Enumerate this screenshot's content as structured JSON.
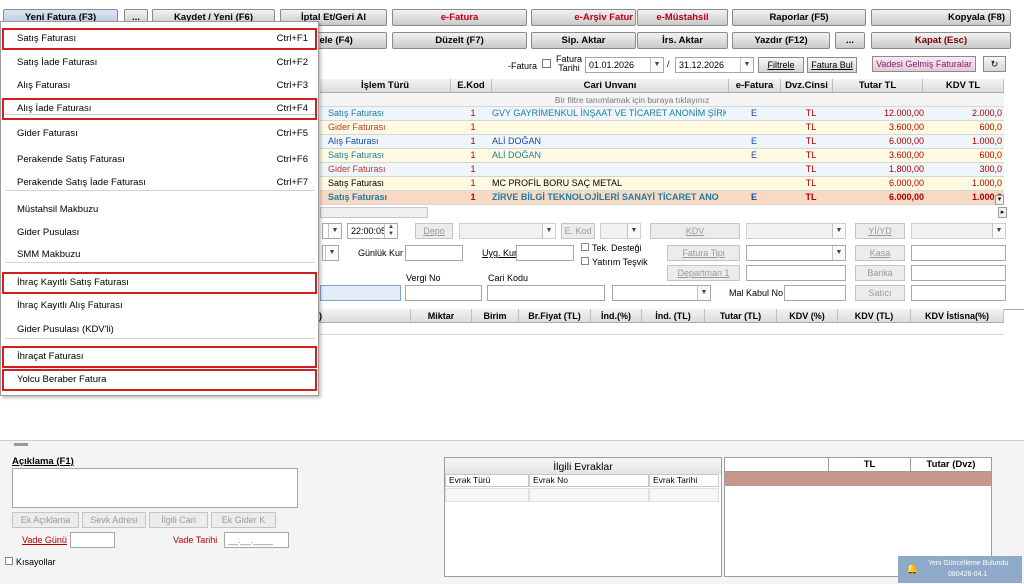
{
  "toolbar": {
    "row1": [
      "Yeni Fatura (F3)",
      "...",
      "Kaydet / Yeni (F6)",
      "İptal Et/Geri Al",
      "e-Fatura",
      "e-Arşiv Fatur",
      "e-Müstahsil",
      "Raporlar (F5)",
      "Kopyala (F8)"
    ],
    "row2": [
      "çele (F4)",
      "Düzelt (F7)",
      "Sip. Aktar",
      "İrs. Aktar",
      "Yazdır (F12)",
      "...",
      "Kapat (Esc)"
    ]
  },
  "menu": {
    "items": [
      {
        "label": "Satış Faturası",
        "shortcut": "Ctrl+F1"
      },
      {
        "label": "Satış İade Faturası",
        "shortcut": "Ctrl+F2"
      },
      {
        "label": "Alış Faturası",
        "shortcut": "Ctrl+F3"
      },
      {
        "label": "Alış İade Faturası",
        "shortcut": "Ctrl+F4"
      },
      {
        "label": "Gider Faturası",
        "shortcut": "Ctrl+F5"
      },
      {
        "label": "Perakende Satış Faturası",
        "shortcut": "Ctrl+F6"
      },
      {
        "label": "Perakende Satış İade Faturası",
        "shortcut": "Ctrl+F7"
      },
      {
        "label": "Müstahsil Makbuzu",
        "shortcut": ""
      },
      {
        "label": "Gider Pusulası",
        "shortcut": ""
      },
      {
        "label": "SMM Makbuzu",
        "shortcut": ""
      },
      {
        "label": "İhraç Kayıtlı Satış Faturası",
        "shortcut": ""
      },
      {
        "label": "İhraç Kayıtlı Alış Faturası",
        "shortcut": ""
      },
      {
        "label": "Gider Pusulası (KDV'li)",
        "shortcut": ""
      },
      {
        "label": "İhraçat Faturası",
        "shortcut": ""
      },
      {
        "label": "Yolcu Beraber Fatura",
        "shortcut": ""
      }
    ]
  },
  "filter": {
    "label_efatura": "-Fatura",
    "label_fatura_tarihi": "Fatura Tarihi",
    "date_from": "01.01.2026",
    "date_to": "31.12.2026",
    "slash": "/",
    "filtrele": "Filtrele",
    "fatura_bul": "Fatura Bul",
    "vadesi_gelmis": "Vadesi Gelmiş Faturalar",
    "refresh_icon": "refresh-icon"
  },
  "grid": {
    "headers": [
      "İşlem Türü",
      "E.Kod",
      "Cari Unvanı",
      "e-Fatura",
      "Dvz.Cinsi",
      "Tutar TL",
      "KDV TL"
    ],
    "filter_hint": "Bir filtre tanımlamak için buraya tıklayınız",
    "rows": [
      {
        "islem": "Satış Faturası",
        "ekod": "1",
        "cari": "GVY GAYRİMENKUL İNŞAAT VE TİCARET ANONİM ŞİRKET",
        "efatura": "E",
        "dvz": "TL",
        "tutar": "12.000,00",
        "kdv": "2.000,0",
        "bg": "#eef5fb",
        "color": "#1e7ca3"
      },
      {
        "islem": "Gider Faturası",
        "ekod": "1",
        "cari": "",
        "efatura": "",
        "dvz": "TL",
        "tutar": "3.600,00",
        "kdv": "600,0",
        "bg": "#fffbe3",
        "color": "#c0392b"
      },
      {
        "islem": "Alış Faturası",
        "ekod": "1",
        "cari": "ALİ DOĞAN",
        "efatura": "E",
        "dvz": "TL",
        "tutar": "6.000,00",
        "kdv": "1.000,0",
        "bg": "#eef5fb",
        "color": "#1a4aa0"
      },
      {
        "islem": "Satış Faturası",
        "ekod": "1",
        "cari": "ALİ DOĞAN",
        "efatura": "E",
        "dvz": "TL",
        "tutar": "3.600,00",
        "kdv": "600,0",
        "bg": "#fffbe3",
        "color": "#1e7ca3"
      },
      {
        "islem": "Gider Faturası",
        "ekod": "1",
        "cari": "",
        "efatura": "",
        "dvz": "TL",
        "tutar": "1.800,00",
        "kdv": "300,0",
        "bg": "#eef5fb",
        "color": "#c0392b"
      },
      {
        "islem": "Satış Faturası",
        "ekod": "1",
        "cari": "MC PROFİL BORU SAÇ METAL",
        "efatura": "",
        "dvz": "TL",
        "tutar": "6.000,00",
        "kdv": "1.000,0",
        "bg": "#fffbe3",
        "color": "#000000"
      },
      {
        "islem": "Satış Faturası",
        "ekod": "1",
        "cari": "ZİRVE BİLGİ TEKNOLOJİLERİ SANAYİ TİCARET ANO",
        "efatura": "E",
        "dvz": "TL",
        "tutar": "6.000,00",
        "kdv": "1.000,0",
        "bg": "#f7d9c4",
        "color": "#1e7ca3"
      }
    ]
  },
  "form": {
    "time": "22:00:05",
    "depo": "Depo",
    "e_kod": "E. Kod",
    "kdv": "KDV",
    "yi_yd": "Yİ/YD",
    "gunluk_kur": "Günlük Kur",
    "uyg_kur": "Uyg. Kur",
    "tek_destegi": "Tek. Desteği",
    "yatirim_tesvik": "Yatırım Teşvik",
    "fatura_tipi": "Fatura Tipi",
    "kasa": "Kasa",
    "departman": "Departman 1",
    "banka": "Banka",
    "vergi_no": "Vergi No",
    "cari_kodu": "Cari Kodu",
    "mal_kabul_no": "Mal Kabul No",
    "satici": "Satıcı"
  },
  "detail_headers": [
    ")",
    "Miktar",
    "Birim",
    "Br.Fiyat (TL)",
    "İnd.(%)",
    "İnd. (TL)",
    "Tutar (TL)",
    "KDV (%)",
    "KDV (TL)",
    "KDV İstisna(%)"
  ],
  "bottom": {
    "aciklama": "Açıklama (F1)",
    "ek_aciklama": "Ek Açıklama",
    "sevk_adresi": "Sevk Adresi",
    "ilgili_cari": "İlgili Cari",
    "ek_gider_k": "Ek Gider K",
    "vade_gunu": "Vade Günü",
    "vade_tarihi": "Vade Tarihi",
    "vade_tarihi_value": "__.__.____",
    "kisayollar": "Kısayollar",
    "ilgili_evraklar": "İlgili Evraklar",
    "evrak_cols": [
      "Evrak Türü",
      "Evrak No",
      "Evrak Tarihi"
    ],
    "total_cols": [
      "TL",
      "Tutar (Dvz)"
    ]
  },
  "notification": {
    "line1": "Yeni Güncelleme Bulundu",
    "line2": "080426-04.1"
  }
}
